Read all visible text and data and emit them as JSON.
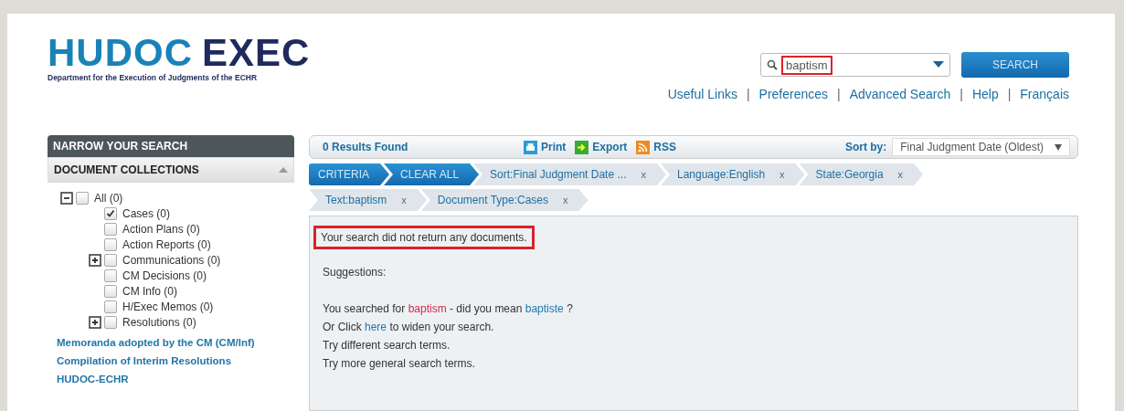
{
  "header": {
    "logo": {
      "primary": "HUDOC",
      "secondary": "EXEC",
      "tagline": "Department for the Execution of Judgments of the ECHR"
    },
    "search": {
      "value": "baptism",
      "highlighted": true,
      "button": "SEARCH"
    },
    "separator": "|",
    "links": [
      "Useful Links",
      "Preferences",
      "Advanced Search",
      "Help",
      "Français"
    ]
  },
  "sidebar": {
    "title": "NARROW YOUR SEARCH",
    "section": {
      "title": "DOCUMENT COLLECTIONS",
      "expanded": true
    },
    "tree": [
      {
        "label": "All (0)",
        "checked": false,
        "expanded": true,
        "children": [
          {
            "label": "Cases (0)",
            "checked": true
          },
          {
            "label": "Action Plans (0)",
            "checked": false
          },
          {
            "label": "Action Reports (0)",
            "checked": false
          },
          {
            "label": "Communications (0)",
            "checked": false,
            "expanded": false
          },
          {
            "label": "CM Decisions (0)",
            "checked": false
          },
          {
            "label": "CM Info (0)",
            "checked": false
          },
          {
            "label": "H/Exec Memos (0)",
            "checked": false
          },
          {
            "label": "Resolutions (0)",
            "checked": false,
            "expanded": false
          }
        ]
      }
    ],
    "links": [
      "Memoranda adopted by the CM (CM/Inf)",
      "Compilation of Interim Resolutions",
      "HUDOC-ECHR"
    ]
  },
  "results": {
    "count": "0 Results Found",
    "actions": [
      {
        "kind": "print",
        "label": "Print"
      },
      {
        "kind": "export",
        "label": "Export"
      },
      {
        "kind": "rss",
        "label": "RSS"
      }
    ],
    "sort_label": "Sort by:",
    "sort_value": "Final Judgment Date (Oldest)"
  },
  "criteria": {
    "label": "CRITERIA",
    "clear": "CLEAR ALL",
    "filters": [
      {
        "label": "Sort:Final Judgment Date ...",
        "remove": "x"
      },
      {
        "label": "Language:English",
        "remove": "x"
      },
      {
        "label": "State:Georgia",
        "remove": "x"
      },
      {
        "label": "Text:baptism",
        "remove": "x"
      },
      {
        "label": "Document Type:Cases",
        "remove": "x"
      }
    ]
  },
  "message": {
    "text": "Your search did not return any documents.",
    "highlighted": true,
    "suggestions_title": "Suggestions:",
    "did_you_mean": {
      "before": "You searched for",
      "term": "baptism",
      "middle": "- did you mean",
      "suggestion": "baptiste",
      "after": "?"
    },
    "widen": {
      "before": "Or Click",
      "link": "here",
      "after": "to widen your search."
    },
    "tips": [
      "Try different search terms.",
      "Try more general search terms."
    ]
  }
}
